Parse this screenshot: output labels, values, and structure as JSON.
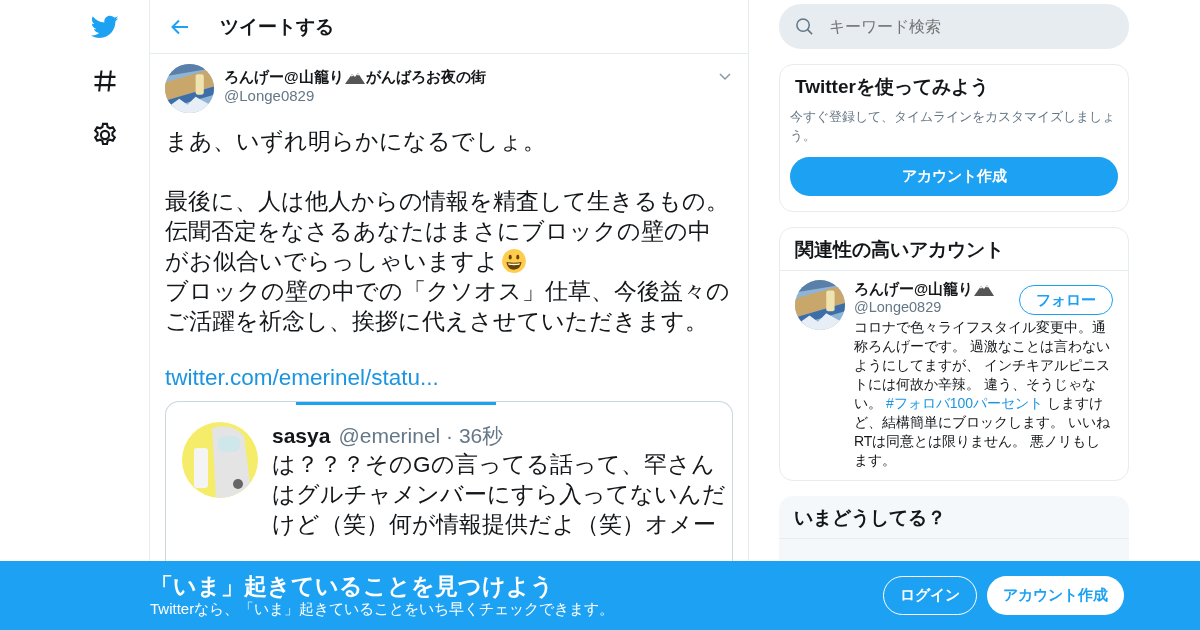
{
  "nav": [
    {
      "kind": "bird"
    },
    {
      "kind": "hash"
    },
    {
      "kind": "gear"
    }
  ],
  "header": {
    "title": "ツイートする"
  },
  "tweet": {
    "name_parts": [
      "ろんげー@山籠り",
      "がんばろお夜の街"
    ],
    "handle": "@Longe0829",
    "body": [
      {
        "kind": "paragraph",
        "lines": [
          "まあ、いずれ明らかになるでしょ。"
        ],
        "emoji": false
      },
      {
        "kind": "paragraph",
        "lines": [
          "最後に、人は他人からの情報を精査して生きるもの。",
          "伝聞否定をなさるあなたはまさにブロックの壁の中",
          "がお似合いでらっしゃいますよ"
        ],
        "emoji": true
      },
      {
        "kind": "line",
        "lines": [
          "ブロックの壁の中での「クソオス」仕草、今後益々の",
          "ご活躍を祈念し、挨拶に代えさせていただきます。"
        ],
        "emoji": false
      }
    ],
    "link": "twitter.com/emerinel/statu...",
    "media": {
      "name": "sasya",
      "handle": "@emerinel · 36秒",
      "lines": [
        "は？？？そのGの言ってる話って、罕さん",
        "はグルチャメンバーにすら入ってないんだ",
        "けど（笑）何が情報提供だよ（笑）オメー"
      ]
    }
  },
  "search": {
    "placeholder": "キーワード検索"
  },
  "signup_card": {
    "title": "Twitterを使ってみよう",
    "text": "今すぐ登録して、タイムラインをカスタマイズしましょう。",
    "button": "アカウント作成"
  },
  "related": {
    "title": "関連性の高いアカウント",
    "account": {
      "name": "ろんげー@山籠り",
      "handle": "@Longe0829",
      "button": "フォロー",
      "bio": [
        {
          "kind": "text",
          "text": "コロナで色々ライフスタイル変更中。通称ろんげーです。 過激なことは言わないようにしてますが、 インチキアルピニストには何故か辛辣。 違う、そうじゃない。 "
        },
        {
          "kind": "hashtag",
          "text": "#フォロバ100パーセント"
        },
        {
          "kind": "text",
          "text": " しますけど、結構簡単にブロックします。 いいねRTは同意とは限りません。 悪ノリもします。"
        }
      ]
    }
  },
  "trends": {
    "title": "いまどうしてる？"
  },
  "banner": {
    "title": "「いま」起きていることを見つけよう",
    "subtitle": "Twitterなら、「いま」起きていることをいち早くチェックできます。",
    "buttons": [
      {
        "label": "ログイン",
        "kind": "outline"
      },
      {
        "label": "アカウント作成",
        "kind": "solid"
      }
    ]
  }
}
